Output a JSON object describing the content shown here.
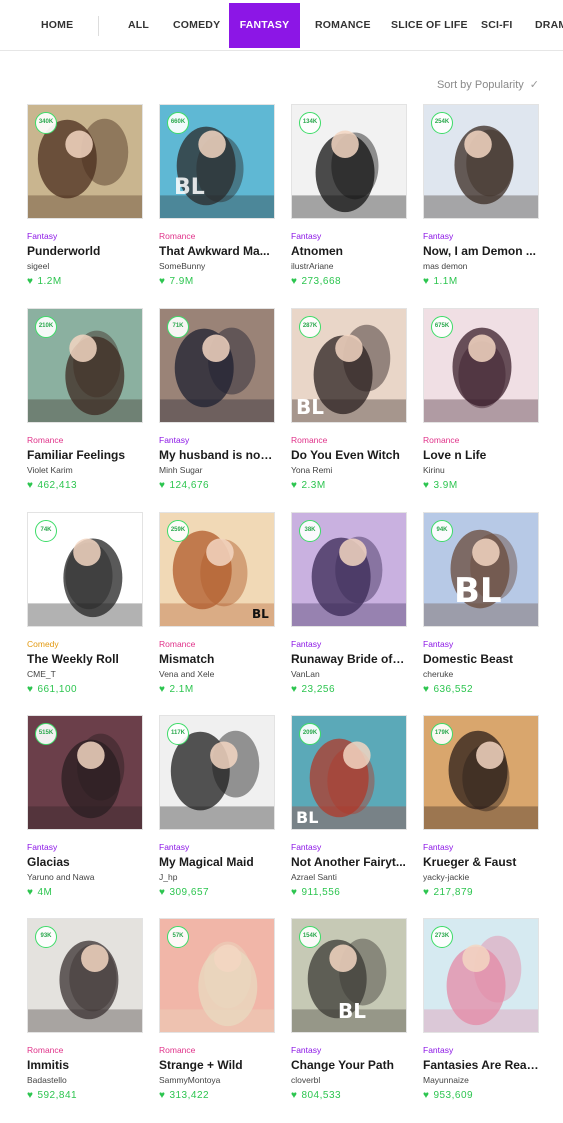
{
  "nav": {
    "home": "HOME",
    "tabs": [
      "ALL",
      "COMEDY",
      "FANTASY",
      "ROMANCE",
      "SLICE OF LIFE",
      "SCI-FI",
      "DRAMA"
    ],
    "active": "FANTASY"
  },
  "sort": {
    "label": "Sort by Popularity",
    "check": "✓"
  },
  "comics": [
    {
      "genre": "Fantasy",
      "title": "Punderworld",
      "author": "sigeel",
      "likes": "1.2M",
      "subs": "340K",
      "bg": "#c9b58f",
      "fg": "#4a2e1e"
    },
    {
      "genre": "Romance",
      "title": "That Awkward Ma...",
      "author": "SomeBunny",
      "likes": "7.9M",
      "subs": "660K",
      "bg": "#5fb8d4",
      "fg": "#2b2b2b"
    },
    {
      "genre": "Fantasy",
      "title": "Atnomen",
      "author": "ilustrAriane",
      "likes": "273,668",
      "subs": "134K",
      "bg": "#f2f2f2",
      "fg": "#111111"
    },
    {
      "genre": "Fantasy",
      "title": "Now, I am Demon ...",
      "author": "mas demon",
      "likes": "1.1M",
      "subs": "254K",
      "bg": "#dfe6ef",
      "fg": "#3a2a22"
    },
    {
      "genre": "Romance",
      "title": "Familiar Feelings",
      "author": "Violet Karim",
      "likes": "462,413",
      "subs": "210K",
      "bg": "#8bb0a0",
      "fg": "#3d2a22"
    },
    {
      "genre": "Fantasy",
      "title": "My husband is no l...",
      "author": "Minh Sugar",
      "likes": "124,676",
      "subs": "71K",
      "bg": "#9a8377",
      "fg": "#1e2030"
    },
    {
      "genre": "Romance",
      "title": "Do You Even Witch",
      "author": "Yona Remi",
      "likes": "2.3M",
      "subs": "287K",
      "bg": "#e9d6c8",
      "fg": "#2a2020"
    },
    {
      "genre": "Romance",
      "title": "Love n Life",
      "author": "Kirinu",
      "likes": "3.9M",
      "subs": "675K",
      "bg": "#f0dfe4",
      "fg": "#3a1d2a"
    },
    {
      "genre": "Comedy",
      "title": "The Weekly Roll",
      "author": "CME_T",
      "likes": "661,100",
      "subs": "74K",
      "bg": "#ffffff",
      "fg": "#222222"
    },
    {
      "genre": "Romance",
      "title": "Mismatch",
      "author": "Vena and Xele",
      "likes": "2.1M",
      "subs": "259K",
      "bg": "#f1d9b6",
      "fg": "#b05a2a"
    },
    {
      "genre": "Fantasy",
      "title": "Runaway Bride of t...",
      "author": "VanLan",
      "likes": "23,256",
      "subs": "38K",
      "bg": "#c9b1e0",
      "fg": "#3a2a55"
    },
    {
      "genre": "Fantasy",
      "title": "Domestic Beast",
      "author": "cheruke",
      "likes": "636,552",
      "subs": "94K",
      "bg": "#b7c9e6",
      "fg": "#6a4a3a"
    },
    {
      "genre": "Fantasy",
      "title": "Glacias",
      "author": "Yaruno and Nawa",
      "likes": "4M",
      "subs": "515K",
      "bg": "#6b3f4a",
      "fg": "#2a1f22"
    },
    {
      "genre": "Fantasy",
      "title": "My Magical Maid",
      "author": "J_hp",
      "likes": "309,657",
      "subs": "117K",
      "bg": "#f0f0f0",
      "fg": "#1c1c1c"
    },
    {
      "genre": "Fantasy",
      "title": "Not Another Fairyt...",
      "author": "Azrael Santi",
      "likes": "911,556",
      "subs": "209K",
      "bg": "#5ba9b8",
      "fg": "#b03a2a"
    },
    {
      "genre": "Fantasy",
      "title": "Krueger & Faust",
      "author": "yacky-jackie",
      "likes": "217,879",
      "subs": "179K",
      "bg": "#d9a66d",
      "fg": "#2b1e1a"
    },
    {
      "genre": "Romance",
      "title": "Immitis",
      "author": "Badastello",
      "likes": "592,841",
      "subs": "93K",
      "bg": "#e4e2de",
      "fg": "#3a3030"
    },
    {
      "genre": "Romance",
      "title": "Strange + Wild",
      "author": "SammyMontoya",
      "likes": "313,422",
      "subs": "57K",
      "bg": "#f1b6a8",
      "fg": "#e8d9c0"
    },
    {
      "genre": "Fantasy",
      "title": "Change Your Path",
      "author": "cloverbl",
      "likes": "804,533",
      "subs": "154K",
      "bg": "#c6c9b5",
      "fg": "#3b3a35"
    },
    {
      "genre": "Fantasy",
      "title": "Fantasies Are Reali...",
      "author": "Mayunnaize",
      "likes": "953,609",
      "subs": "273K",
      "bg": "#d6eaf1",
      "fg": "#e48aa6"
    }
  ],
  "bl_label": "BL",
  "heart_icon": "♥"
}
